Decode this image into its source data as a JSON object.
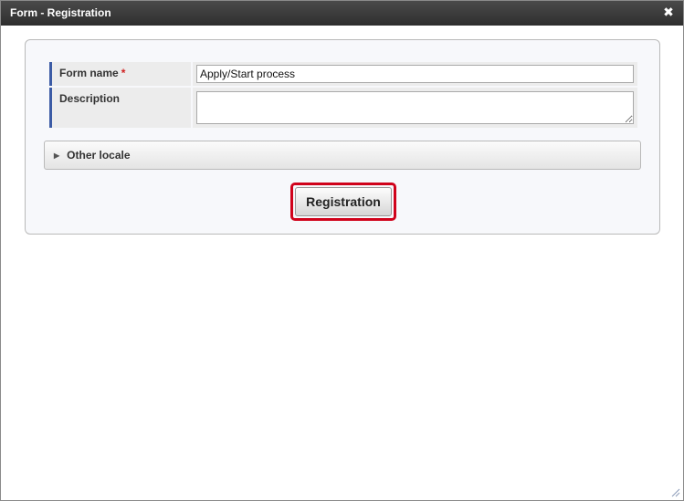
{
  "window": {
    "title": "Form - Registration",
    "close_icon": "close-icon"
  },
  "form": {
    "fields": [
      {
        "label": "Form name",
        "required": true,
        "required_mark": "*",
        "value": "Apply/Start process"
      },
      {
        "label": "Description",
        "required": false,
        "value": ""
      }
    ],
    "other_locale_label": "Other locale",
    "submit_label": "Registration"
  },
  "colors": {
    "titlebar": "#3a3a3a",
    "label_accent": "#3b5ba5",
    "highlight": "#d0021b"
  }
}
